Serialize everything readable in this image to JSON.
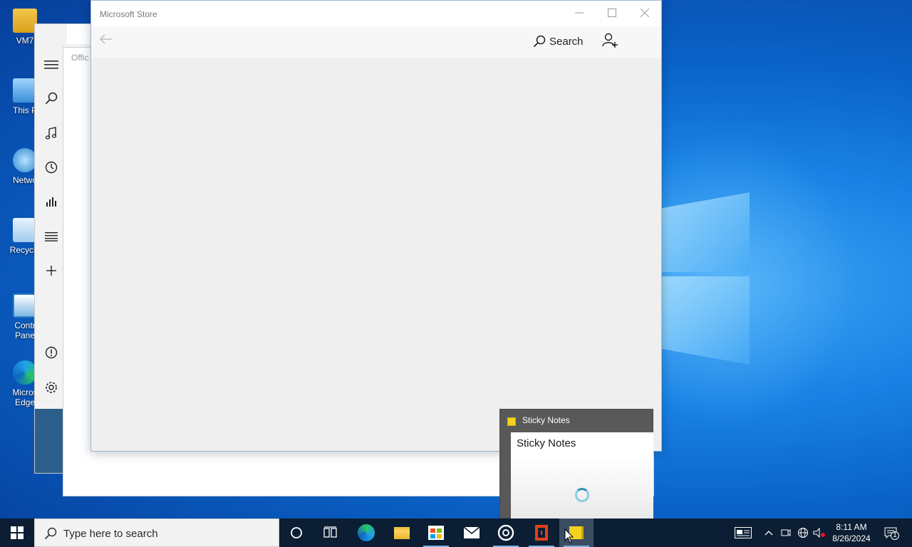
{
  "desktop": {
    "icons": [
      {
        "name": "desktop-icon-vm",
        "label": "VM7"
      },
      {
        "name": "desktop-icon-this-pc",
        "label": "This P"
      },
      {
        "name": "desktop-icon-network",
        "label": "Netwo"
      },
      {
        "name": "desktop-icon-recycle-bin",
        "label": "Recycle"
      },
      {
        "name": "desktop-icon-control-panel",
        "label": "Contr\nPane"
      },
      {
        "name": "desktop-icon-edge",
        "label": "Micros\nEdge"
      }
    ]
  },
  "groove": {
    "rail_icons": [
      "menu-icon",
      "search-icon",
      "music-note-icon",
      "clock-icon",
      "chart-icon",
      "list-icon",
      "plus-icon",
      "alert-icon",
      "gear-icon"
    ]
  },
  "office": {
    "title": "Offic"
  },
  "store": {
    "title": "Microsoft Store",
    "search_label": "Search",
    "caption": {
      "minimize": "—",
      "maximize": "☐",
      "close": "✕"
    },
    "back": "←"
  },
  "sticky": {
    "window_title": "Sticky Notes",
    "body_title": "Sticky Notes"
  },
  "taskbar": {
    "search_placeholder": "Type here to search",
    "pinned": [
      "cortana-icon",
      "task-view-icon",
      "edge-icon",
      "file-explorer-icon",
      "store-icon",
      "mail-icon",
      "groove-icon",
      "office-icon",
      "sticky-notes-icon"
    ],
    "clock_time": "8:11 AM",
    "clock_date": "8/26/2024",
    "notification_count": "1"
  },
  "colors": {
    "taskbar": "#0b1e33",
    "sticky_yellow": "#f4d21f",
    "office_red": "#e3411b",
    "accent": "#0a63c8"
  }
}
